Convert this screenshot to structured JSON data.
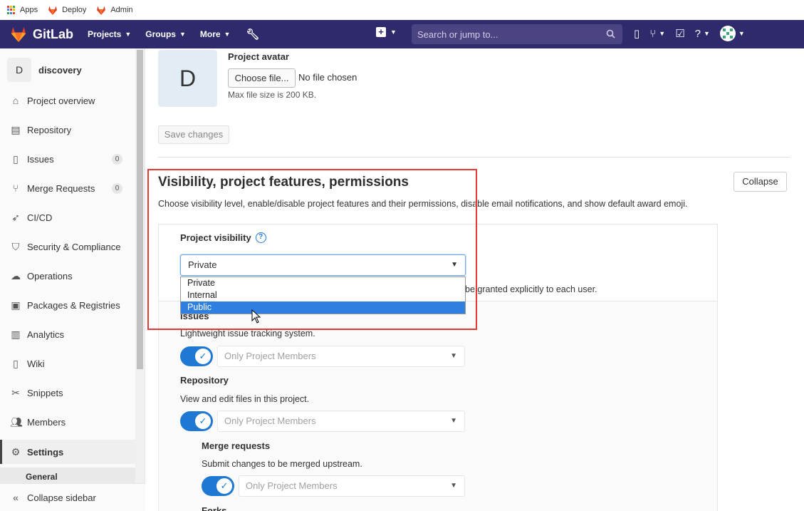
{
  "bookmarks": [
    {
      "label": "Apps",
      "icon": "apps-grid-icon"
    },
    {
      "label": "Deploy",
      "icon": "gitlab-fox-icon"
    },
    {
      "label": "Admin",
      "icon": "gitlab-fox-icon"
    }
  ],
  "navbar": {
    "brand": "GitLab",
    "links": [
      "Projects",
      "Groups",
      "More"
    ],
    "search_placeholder": "Search or jump to...",
    "colors": {
      "background": "#2f2a6b",
      "accent": "#1f78d1"
    }
  },
  "sidebar": {
    "project_initial": "D",
    "project_name": "discovery",
    "items": [
      {
        "label": "Project overview",
        "icon": "home-icon"
      },
      {
        "label": "Repository",
        "icon": "doc-icon"
      },
      {
        "label": "Issues",
        "icon": "issues-icon",
        "count": "0"
      },
      {
        "label": "Merge Requests",
        "icon": "merge-icon",
        "count": "0"
      },
      {
        "label": "CI/CD",
        "icon": "rocket-icon"
      },
      {
        "label": "Security & Compliance",
        "icon": "shield-icon"
      },
      {
        "label": "Operations",
        "icon": "cloud-icon"
      },
      {
        "label": "Packages & Registries",
        "icon": "package-icon"
      },
      {
        "label": "Analytics",
        "icon": "chart-icon"
      },
      {
        "label": "Wiki",
        "icon": "book-icon"
      },
      {
        "label": "Snippets",
        "icon": "scissors-icon"
      },
      {
        "label": "Members",
        "icon": "users-icon"
      },
      {
        "label": "Settings",
        "icon": "gear-icon"
      }
    ],
    "sub_item": "General",
    "collapse_label": "Collapse sidebar"
  },
  "main": {
    "avatar": {
      "initial": "D",
      "title": "Project avatar",
      "choose_label": "Choose file...",
      "no_file": "No file chosen",
      "max_size": "Max file size is 200 KB."
    },
    "save_label": "Save changes",
    "section": {
      "title": "Visibility, project features, permissions",
      "description": "Choose visibility level, enable/disable project features and their permissions, disable email notifications, and show default award emoji.",
      "collapse_label": "Collapse"
    },
    "visibility": {
      "label": "Project visibility",
      "selected": "Private",
      "options": [
        "Private",
        "Internal",
        "Public"
      ],
      "highlighted": "Public",
      "hint_partial": "be granted explicitly to each user."
    },
    "features": [
      {
        "title": "Issues",
        "desc": "Lightweight issue tracking system.",
        "access": "Only Project Members",
        "enabled": true
      },
      {
        "title": "Repository",
        "desc": "View and edit files in this project.",
        "access": "Only Project Members",
        "enabled": true
      },
      {
        "title": "Merge requests",
        "desc": "Submit changes to be merged upstream.",
        "access": "Only Project Members",
        "enabled": true
      },
      {
        "title": "Forks",
        "desc": "",
        "access": "",
        "enabled": true
      }
    ]
  }
}
